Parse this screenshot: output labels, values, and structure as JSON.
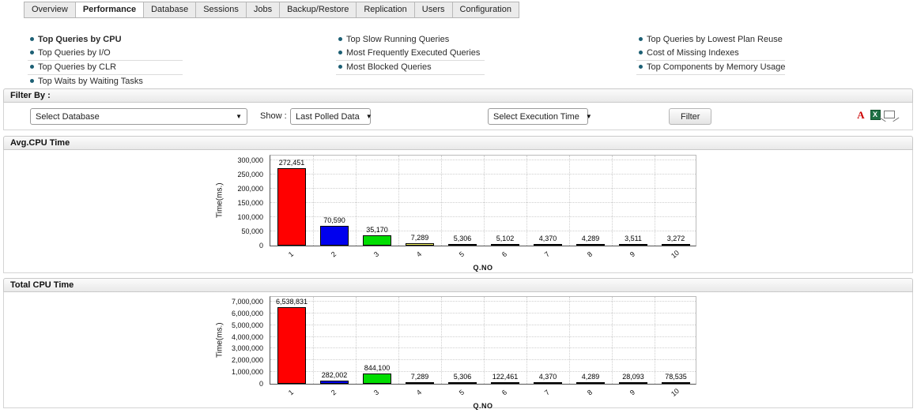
{
  "tabs": {
    "items": [
      {
        "label": "Overview",
        "active": false
      },
      {
        "label": "Performance",
        "active": true
      },
      {
        "label": "Database",
        "active": false
      },
      {
        "label": "Sessions",
        "active": false
      },
      {
        "label": "Jobs",
        "active": false
      },
      {
        "label": "Backup/Restore",
        "active": false
      },
      {
        "label": "Replication",
        "active": false
      },
      {
        "label": "Users",
        "active": false
      },
      {
        "label": "Configuration",
        "active": false
      }
    ]
  },
  "quick_links": {
    "columns": [
      {
        "items": [
          {
            "label": "Top Queries by CPU",
            "active": true
          },
          {
            "label": "Top Queries by I/O",
            "active": false
          },
          {
            "label": "Top Queries by CLR",
            "active": false
          },
          {
            "label": "Top Waits by Waiting Tasks",
            "active": false
          }
        ]
      },
      {
        "items": [
          {
            "label": "Top Slow Running Queries",
            "active": false
          },
          {
            "label": "Most Frequently Executed Queries",
            "active": false
          },
          {
            "label": "Most Blocked Queries",
            "active": false
          }
        ]
      },
      {
        "items": [
          {
            "label": "Top Queries by Lowest Plan Reuse",
            "active": false
          },
          {
            "label": "Cost of Missing Indexes",
            "active": false
          },
          {
            "label": "Top Components by Memory Usage",
            "active": false
          }
        ]
      }
    ]
  },
  "filter": {
    "title": "Filter By :",
    "database_select_value": "Select Database",
    "show_label": "Show :",
    "show_select_value": "Last Polled Data",
    "execution_select_value": "Select Execution Time",
    "filter_button_label": "Filter",
    "export_icons": [
      "pdf-export-icon",
      "excel-export-icon",
      "email-icon"
    ]
  },
  "chart_data": [
    {
      "type": "bar",
      "title": "Avg.CPU Time",
      "xlabel": "Q.NO",
      "ylabel": "Time(ms.)",
      "ylim": [
        0,
        300000
      ],
      "ytick_step": 50000,
      "grid": true,
      "legend": false,
      "categories": [
        "1",
        "2",
        "3",
        "4",
        "5",
        "6",
        "7",
        "8",
        "9",
        "10"
      ],
      "values": [
        272451,
        70590,
        35170,
        7289,
        5306,
        5102,
        4370,
        4289,
        3511,
        3272
      ],
      "colors": [
        "#ff0000",
        "#0000ee",
        "#00dd00",
        "#ffff66",
        "#ffaa00",
        "#2ab5b5",
        "#cc22cc",
        "#1a3399",
        "#aa1111",
        "#223399"
      ]
    },
    {
      "type": "bar",
      "title": "Total CPU Time",
      "xlabel": "Q.NO",
      "ylabel": "Time(ms.)",
      "ylim": [
        0,
        7000000
      ],
      "ytick_step": 1000000,
      "grid": true,
      "legend": false,
      "categories": [
        "1",
        "2",
        "3",
        "4",
        "5",
        "6",
        "7",
        "8",
        "9",
        "10"
      ],
      "values": [
        6538831,
        282002,
        844100,
        7289,
        5306,
        122461,
        4370,
        4289,
        28093,
        78535
      ],
      "colors": [
        "#ff0000",
        "#0000ee",
        "#00dd00",
        "#ffff66",
        "#ffaa00",
        "#2ab5b5",
        "#cc22cc",
        "#1a3399",
        "#aa1111",
        "#223399"
      ]
    }
  ]
}
